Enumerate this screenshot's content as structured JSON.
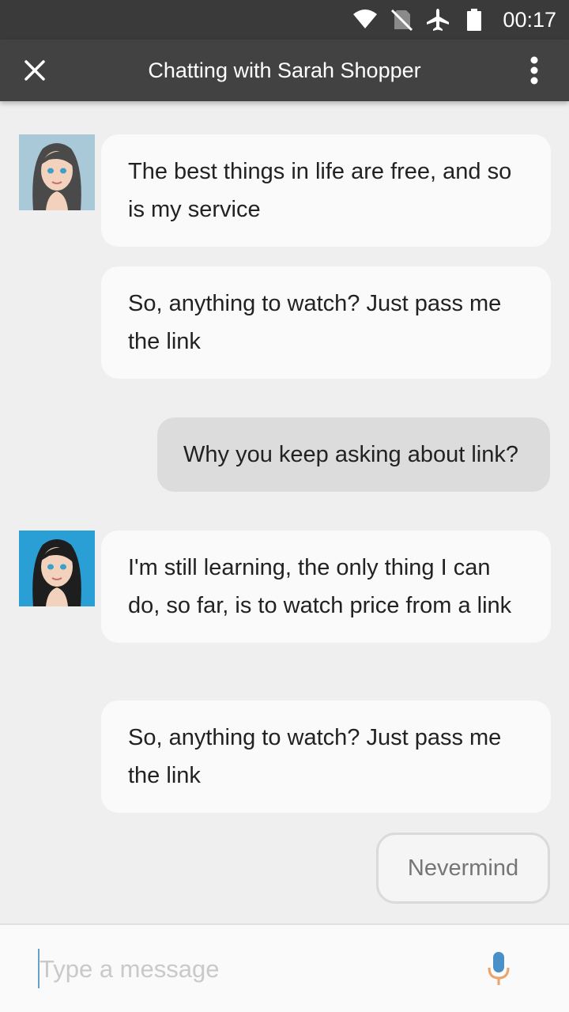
{
  "status_bar": {
    "time": "00:17",
    "icons": [
      "wifi-icon",
      "no-sim-icon",
      "airplane-icon",
      "battery-icon"
    ]
  },
  "app_bar": {
    "title": "Chatting with Sarah Shopper",
    "close_icon": "close-icon",
    "menu_icon": "more-vert-icon"
  },
  "messages": [
    {
      "sender": "bot",
      "text": "The best things in life are free, and so is my service"
    },
    {
      "sender": "bot",
      "text": "So, anything to watch? Just pass me the link"
    },
    {
      "sender": "user",
      "text": "Why you keep asking about link?"
    },
    {
      "sender": "bot",
      "text": "I'm still learning, the only thing I can do, so far, is to watch price from a link"
    },
    {
      "sender": "bot",
      "text": "So, anything to watch? Just pass me the link"
    }
  ],
  "quick_reply": {
    "label": "Nevermind"
  },
  "input": {
    "placeholder": "Type a message",
    "value": "",
    "mic_icon": "microphone-icon"
  },
  "colors": {
    "status_bar": "#3a3a3a",
    "app_bar": "#424242",
    "background": "#efefef",
    "bot_bubble": "#fafafa",
    "user_bubble": "#dcdcdc",
    "mic_blue": "#4a90c8",
    "mic_orange": "#e9a36b"
  }
}
